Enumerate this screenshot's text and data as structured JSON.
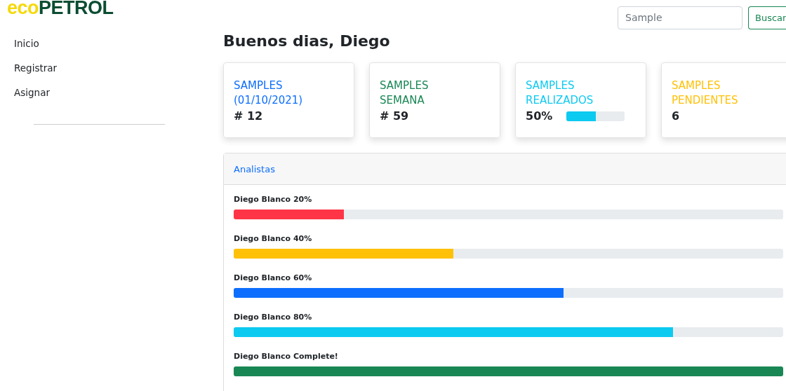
{
  "logo": {
    "prefix": "eco",
    "suffix": "PETROL"
  },
  "search": {
    "placeholder": "Sample",
    "button": "Buscar"
  },
  "sidebar": {
    "items": [
      {
        "label": "Inicio"
      },
      {
        "label": "Registrar"
      },
      {
        "label": "Asignar"
      }
    ]
  },
  "greeting": "Buenos dias, Diego",
  "cards": [
    {
      "title": "SAMPLES (01/10/2021)",
      "value": "# 12",
      "color": "#0d6efd"
    },
    {
      "title": "SAMPLES SEMANA",
      "value": "# 59",
      "color": "#198754"
    },
    {
      "title": "SAMPLES REALIZADOS",
      "value": "50%",
      "color": "#0dcaf0",
      "level": 0.5
    },
    {
      "title": "SAMPLES PENDIENTES",
      "value": "6",
      "color": "#ffc107"
    }
  ],
  "analysts": {
    "title": "Analistas",
    "rows": [
      {
        "label": "Diego Blanco 20%",
        "level": 0.2,
        "color": "#ff3547"
      },
      {
        "label": "Diego Blanco 40%",
        "level": 0.4,
        "color": "#ffc107"
      },
      {
        "label": "Diego Blanco 60%",
        "level": 0.6,
        "color": "#0d6efd"
      },
      {
        "label": "Diego Blanco 80%",
        "level": 0.8,
        "color": "#0dcaf0"
      },
      {
        "label": "Diego Blanco Complete!",
        "level": 1,
        "color": "#198754"
      }
    ]
  }
}
